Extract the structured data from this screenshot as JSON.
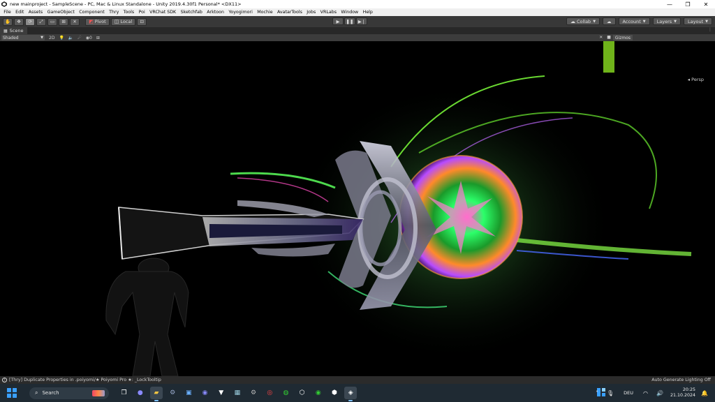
{
  "window": {
    "title": "new mainproject - SampleScene - PC, Mac & Linux Standalone - Unity 2019.4.30f1 Personal* <DX11>",
    "minimize": "—",
    "maximize": "❐",
    "close": "✕"
  },
  "menu": [
    "File",
    "Edit",
    "Assets",
    "GameObject",
    "Component",
    "Thry",
    "Tools",
    "Poi",
    "VRChat SDK",
    "Sketchfab",
    "Arktoon",
    "Yoyogimori",
    "Mochie",
    "AvatarTools",
    "Jobs",
    "VRLabs",
    "Window",
    "Help"
  ],
  "toolbar": {
    "pivot_label": "Pivot",
    "local_label": "Local",
    "collab_label": "Collab",
    "account_label": "Account",
    "layers_label": "Layers",
    "layout_label": "Layout"
  },
  "scene": {
    "tab_label": "Scene",
    "shading_mode": "Shaded",
    "mode_2d": "2D",
    "gizmos_label": "Gizmos",
    "persp_label": "◂ Persp",
    "hidden_count": "0"
  },
  "status": {
    "message": "[Thry] Duplicate Properties in .poiyomi/★ Poiyomi Pro ★: _LockTooltip",
    "right_text": "Auto Generate Lighting Off"
  },
  "taskbar": {
    "search_label": "Search",
    "language": "DEU",
    "time": "20:25",
    "date": "21.10.2024",
    "accent": "#3aa0ff"
  }
}
